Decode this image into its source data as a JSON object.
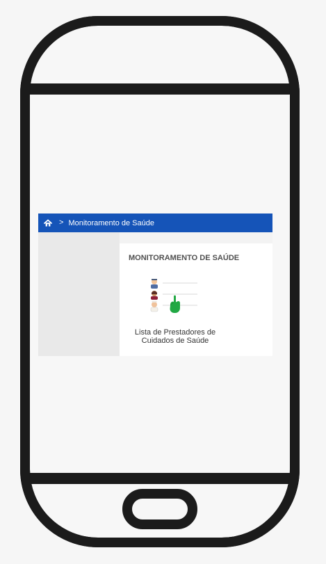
{
  "breadcrumb": {
    "home_icon": "home-icon",
    "separator": ">",
    "current": "Monitoramento de Saúde"
  },
  "card": {
    "title": "MONITORAMENTO DE SAÚDE",
    "caption_line_1": "Lista de Prestadores de",
    "caption_line_2": "Cuidados de Saúde"
  },
  "colors": {
    "topbar": "#1554b8",
    "frame": "#1b1b1b",
    "pointer": "#22a844"
  },
  "icons": {
    "illustration": "provider-list-illustration",
    "pointer": "hand-pointer-icon"
  }
}
